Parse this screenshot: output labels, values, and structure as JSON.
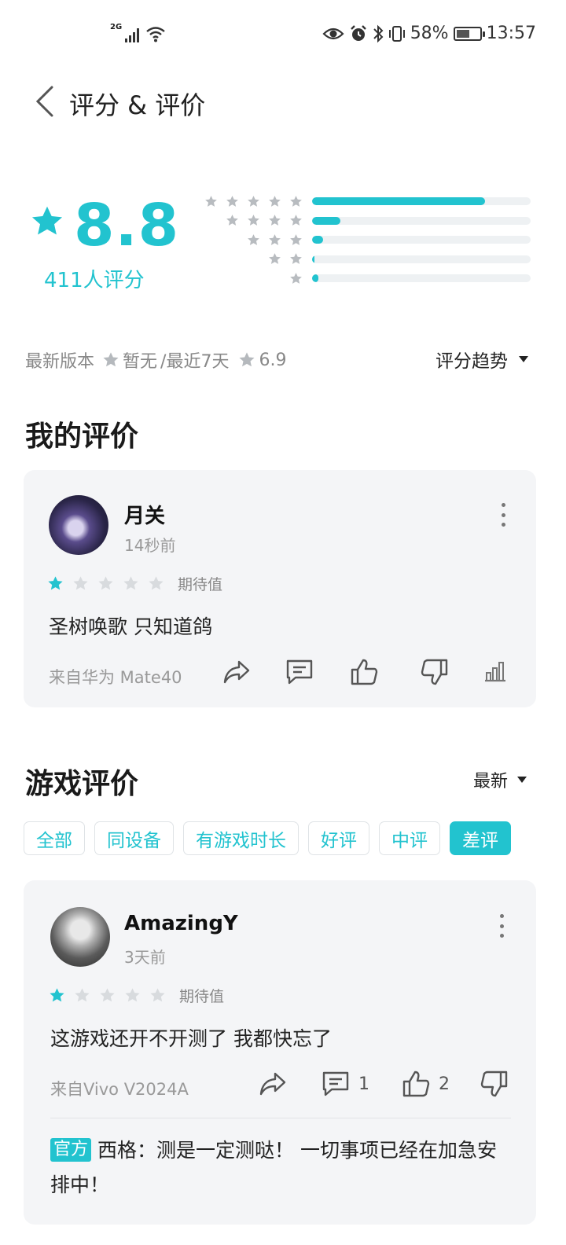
{
  "status_bar": {
    "network": "2G",
    "battery": "58%",
    "battery_level": 0.58,
    "time": "13:57"
  },
  "header": {
    "title": "评分 & 评价"
  },
  "rating": {
    "score": "8.8",
    "count_text": "411人评分",
    "distribution": [
      {
        "stars": 5,
        "fraction": 0.79
      },
      {
        "stars": 4,
        "fraction": 0.13
      },
      {
        "stars": 3,
        "fraction": 0.05
      },
      {
        "stars": 2,
        "fraction": 0.01
      },
      {
        "stars": 1,
        "fraction": 0.03
      }
    ]
  },
  "version_info": {
    "latest_label": "最新版本",
    "latest_value": "暂无",
    "recent_label": "/最近7天",
    "recent_value": "6.9",
    "trend_label": "评分趋势"
  },
  "my_review": {
    "section_title": "我的评价",
    "user": "月关",
    "time": "14秒前",
    "stars": 1,
    "expect_label": "期待值",
    "text": "圣树唤歌 只知道鸽",
    "device": "来自华为 Mate40"
  },
  "game_reviews": {
    "section_title": "游戏评价",
    "sort_label": "最新",
    "filters": [
      "全部",
      "同设备",
      "有游戏时长",
      "好评",
      "中评",
      "差评"
    ],
    "active_filter": "差评",
    "items": [
      {
        "user": "AmazingY",
        "time": "3天前",
        "stars": 1,
        "expect_label": "期待值",
        "text": "这游戏还开不开测了 我都快忘了",
        "device": "来自Vivo V2024A",
        "comment_count": "1",
        "like_count": "2",
        "reply_badge": "官方",
        "reply_text": "西格：测是一定测哒！ 一切事项已经在加急安排中！"
      }
    ]
  },
  "colors": {
    "accent": "#22c3cf",
    "star_inactive": "#d8dbde",
    "card_bg": "#f4f5f7"
  },
  "icons": [
    "back-icon",
    "star-icon",
    "share-icon",
    "comment-icon",
    "thumb-up-icon",
    "thumb-down-icon",
    "chart-icon",
    "more-icon",
    "caret-down-icon",
    "eye-icon",
    "alarm-icon",
    "bluetooth-icon",
    "vibrate-icon",
    "wifi-icon",
    "signal-icon",
    "battery-icon"
  ]
}
